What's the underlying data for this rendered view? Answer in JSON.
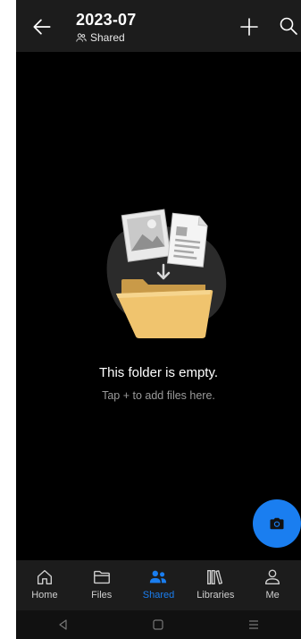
{
  "header": {
    "title": "2023-07",
    "subtitle": "Shared"
  },
  "empty_state": {
    "title": "This folder is empty.",
    "subtitle": "Tap + to add files here."
  },
  "bottom_nav": {
    "items": [
      {
        "label": "Home",
        "icon": "home-icon"
      },
      {
        "label": "Files",
        "icon": "folder-icon"
      },
      {
        "label": "Shared",
        "icon": "people-icon",
        "active": true
      },
      {
        "label": "Libraries",
        "icon": "library-icon"
      },
      {
        "label": "Me",
        "icon": "person-icon"
      }
    ]
  },
  "colors": {
    "accent": "#1a7ef0",
    "background": "#000000",
    "header_bg": "#1c1c1c"
  }
}
